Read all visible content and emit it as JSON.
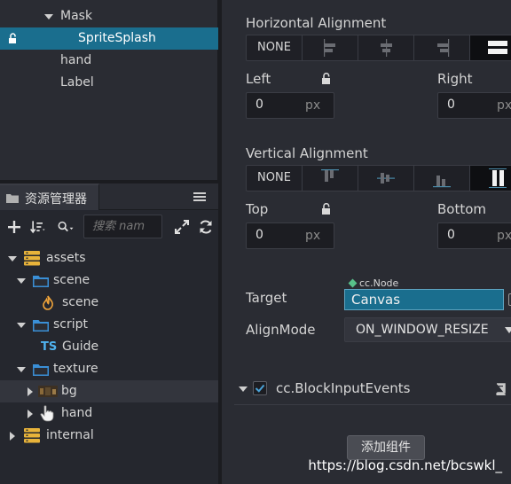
{
  "hierarchy": {
    "items": [
      {
        "label": "Mask"
      },
      {
        "label": "SpriteSplash"
      },
      {
        "label": "hand"
      },
      {
        "label": "Label"
      }
    ]
  },
  "assets": {
    "tab_label": "资源管理器",
    "search_placeholder": "搜索 nam",
    "tree": [
      {
        "label": "assets"
      },
      {
        "label": "scene"
      },
      {
        "label": "scene"
      },
      {
        "label": "script"
      },
      {
        "label": "Guide"
      },
      {
        "label": "texture"
      },
      {
        "label": "bg"
      },
      {
        "label": "hand"
      },
      {
        "label": "internal"
      }
    ],
    "ts_badge": "TS"
  },
  "inspector": {
    "horizontal_alignment": {
      "label": "Horizontal Alignment",
      "none_label": "NONE",
      "selected_index": 4
    },
    "left": {
      "label": "Left",
      "value": "0",
      "unit": "px"
    },
    "right": {
      "label": "Right",
      "value": "0",
      "unit": "px"
    },
    "vertical_alignment": {
      "label": "Vertical Alignment",
      "none_label": "NONE",
      "selected_index": 4
    },
    "top": {
      "label": "Top",
      "value": "0",
      "unit": "px"
    },
    "bottom": {
      "label": "Bottom",
      "value": "0",
      "unit": "px"
    },
    "target": {
      "label": "Target",
      "type_tag": "cc.Node",
      "value": "Canvas"
    },
    "align_mode": {
      "label": "AlignMode",
      "value": "ON_WINDOW_RESIZE"
    },
    "component": {
      "name": "cc.BlockInputEvents",
      "enabled": true
    },
    "add_component_label": "添加组件"
  },
  "watermark": "https://blog.csdn.net/bcswkl_",
  "colors": {
    "selection": "#1a6e8e",
    "folder": "#3a8fd6",
    "assets_db": "#e8b33a"
  }
}
